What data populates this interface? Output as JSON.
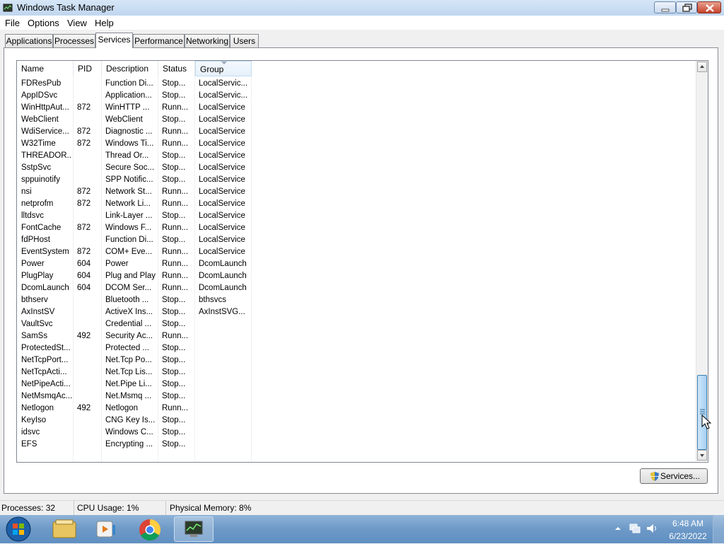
{
  "window": {
    "title": "Windows Task Manager"
  },
  "menu": [
    "File",
    "Options",
    "View",
    "Help"
  ],
  "tabs": [
    "Applications",
    "Processes",
    "Services",
    "Performance",
    "Networking",
    "Users"
  ],
  "active_tab": "Services",
  "columns": [
    "Name",
    "PID",
    "Description",
    "Status",
    "Group"
  ],
  "rows": [
    [
      "FDResPub",
      "",
      "Function Di...",
      "Stop...",
      "LocalServic..."
    ],
    [
      "AppIDSvc",
      "",
      "Application...",
      "Stop...",
      "LocalServic..."
    ],
    [
      "WinHttpAut...",
      "872",
      "WinHTTP ...",
      "Runn...",
      "LocalService"
    ],
    [
      "WebClient",
      "",
      "WebClient",
      "Stop...",
      "LocalService"
    ],
    [
      "WdiService...",
      "872",
      "Diagnostic ...",
      "Runn...",
      "LocalService"
    ],
    [
      "W32Time",
      "872",
      "Windows Ti...",
      "Runn...",
      "LocalService"
    ],
    [
      "THREADOR...",
      "",
      "Thread Or...",
      "Stop...",
      "LocalService"
    ],
    [
      "SstpSvc",
      "",
      "Secure Soc...",
      "Stop...",
      "LocalService"
    ],
    [
      "sppuinotify",
      "",
      "SPP Notific...",
      "Stop...",
      "LocalService"
    ],
    [
      "nsi",
      "872",
      "Network St...",
      "Runn...",
      "LocalService"
    ],
    [
      "netprofm",
      "872",
      "Network Li...",
      "Runn...",
      "LocalService"
    ],
    [
      "lltdsvc",
      "",
      "Link-Layer ...",
      "Stop...",
      "LocalService"
    ],
    [
      "FontCache",
      "872",
      "Windows F...",
      "Runn...",
      "LocalService"
    ],
    [
      "fdPHost",
      "",
      "Function Di...",
      "Stop...",
      "LocalService"
    ],
    [
      "EventSystem",
      "872",
      "COM+ Eve...",
      "Runn...",
      "LocalService"
    ],
    [
      "Power",
      "604",
      "Power",
      "Runn...",
      "DcomLaunch"
    ],
    [
      "PlugPlay",
      "604",
      "Plug and Play",
      "Runn...",
      "DcomLaunch"
    ],
    [
      "DcomLaunch",
      "604",
      "DCOM Ser...",
      "Runn...",
      "DcomLaunch"
    ],
    [
      "bthserv",
      "",
      "Bluetooth ...",
      "Stop...",
      "bthsvcs"
    ],
    [
      "AxInstSV",
      "",
      "ActiveX Ins...",
      "Stop...",
      "AxInstSVG..."
    ],
    [
      "VaultSvc",
      "",
      "Credential ...",
      "Stop...",
      ""
    ],
    [
      "SamSs",
      "492",
      "Security Ac...",
      "Runn...",
      ""
    ],
    [
      "ProtectedSt...",
      "",
      "Protected ...",
      "Stop...",
      ""
    ],
    [
      "NetTcpPort...",
      "",
      "Net.Tcp Po...",
      "Stop...",
      ""
    ],
    [
      "NetTcpActi...",
      "",
      "Net.Tcp Lis...",
      "Stop...",
      ""
    ],
    [
      "NetPipeActi...",
      "",
      "Net.Pipe Li...",
      "Stop...",
      ""
    ],
    [
      "NetMsmqAc...",
      "",
      "Net.Msmq ...",
      "Stop...",
      ""
    ],
    [
      "Netlogon",
      "492",
      "Netlogon",
      "Runn...",
      ""
    ],
    [
      "KeyIso",
      "",
      "CNG Key Is...",
      "Stop...",
      ""
    ],
    [
      "idsvc",
      "",
      "Windows C...",
      "Stop...",
      ""
    ],
    [
      "EFS",
      "",
      "Encrypting ...",
      "Stop...",
      ""
    ]
  ],
  "services_button": "Services...",
  "status": {
    "processes": "Processes: 32",
    "cpu": "CPU Usage: 1%",
    "memory": "Physical Memory: 8%"
  },
  "taskbar": {
    "icons": [
      "start-orb-icon",
      "explorer-icon",
      "media-player-icon",
      "chrome-icon",
      "task-manager-icon"
    ],
    "time": "6:48 AM",
    "date": "6/23/2022"
  },
  "colors": {
    "accent": "#3c7fb1",
    "taskbar": "#6d99c7"
  }
}
